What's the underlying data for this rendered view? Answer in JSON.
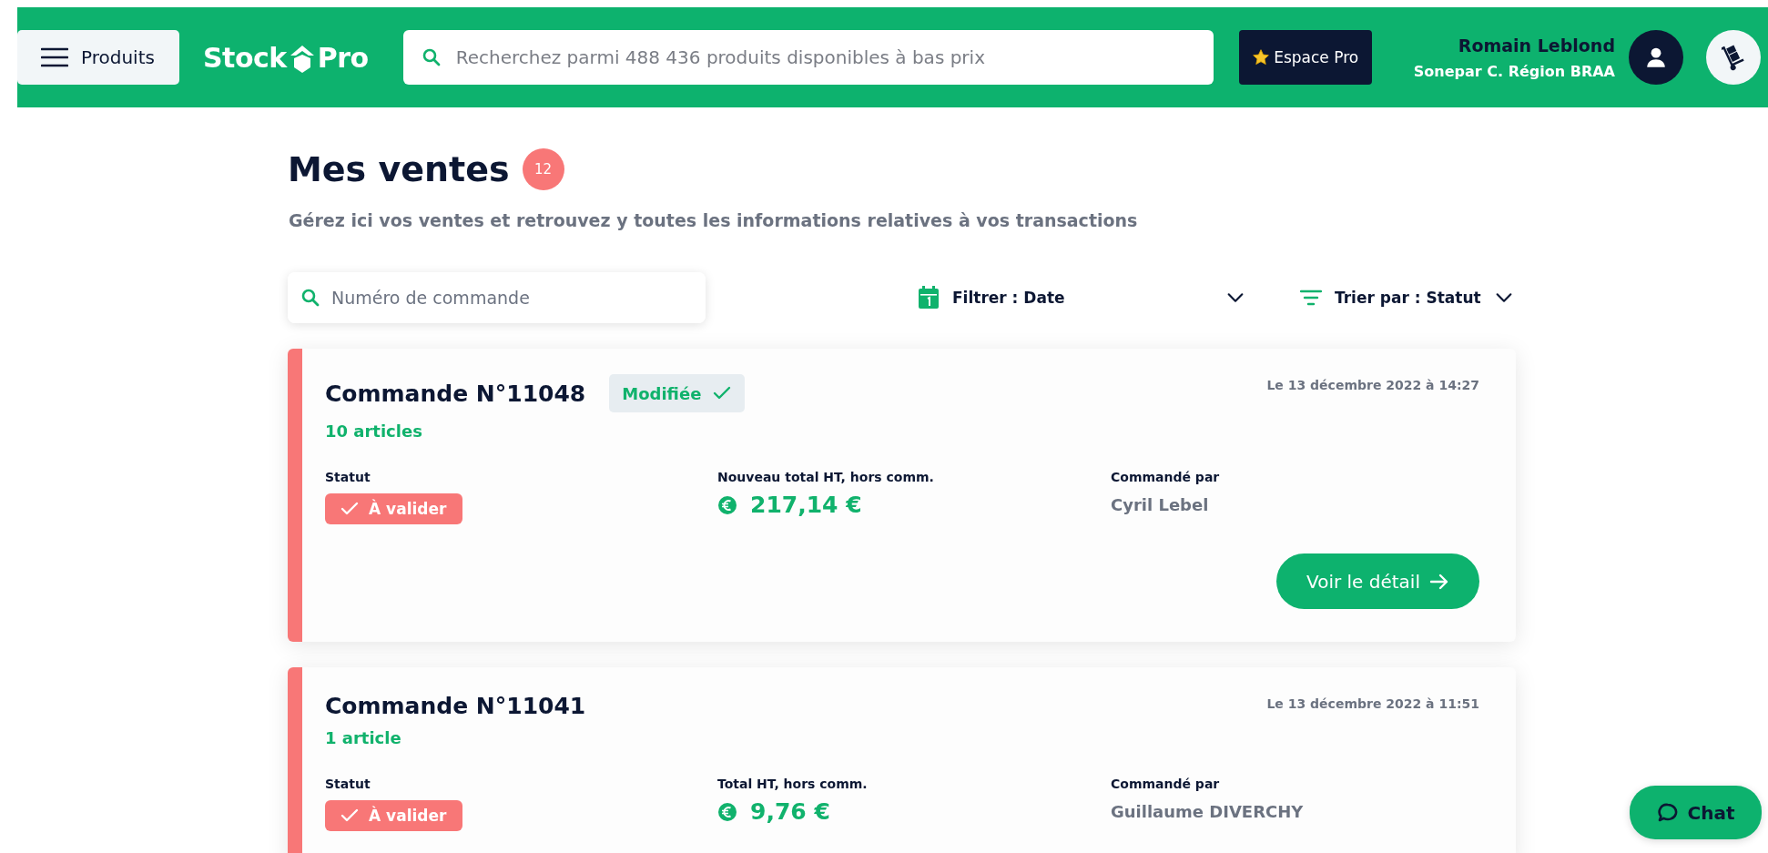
{
  "header": {
    "menu_button": "Produits",
    "logo": {
      "left": "Stock",
      "right": "Pro"
    },
    "search": {
      "placeholder": "Recherchez parmi 488 436 produits disponibles à bas prix"
    },
    "pro_button": "Espace Pro",
    "user": {
      "name": "Romain Leblond",
      "company": "Sonepar C. Région BRAA"
    }
  },
  "page": {
    "title": "Mes ventes",
    "count": "12",
    "subtitle": "Gérez ici vos ventes et retrouvez y toutes les informations relatives à vos transactions"
  },
  "toolbar": {
    "search": {
      "placeholder": "Numéro de commande"
    },
    "filter": "Filtrer : Date",
    "sort": "Trier par : Statut"
  },
  "orders": [
    {
      "title": "Commande N°11048",
      "tag": "Modifiée",
      "date": "Le 13 décembre 2022 à 14:27",
      "articles": "10 articles",
      "status_label": "Statut",
      "status": {
        "label": "À valider",
        "kind": "pending"
      },
      "total_label": "Nouveau total HT, hors comm.",
      "total": "217,14 €",
      "by_label": "Commandé par",
      "by": "Cyril Lebel",
      "button": "Voir le détail"
    },
    {
      "title": "Commande N°11041",
      "date": "Le 13 décembre 2022 à 11:51",
      "articles": "1 article",
      "status_label": "Statut",
      "status": {
        "label": "À valider",
        "kind": "pending"
      },
      "total_label": "Total HT, hors comm.",
      "total": "9,76 €",
      "by_label": "Commandé par",
      "by": "Guillaume DIVERCHY"
    }
  ],
  "chat_button": "Chat"
}
